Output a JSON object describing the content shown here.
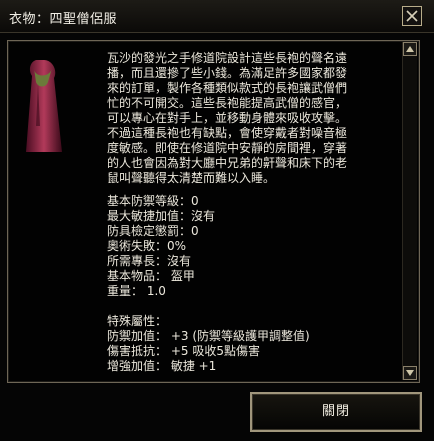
{
  "window": {
    "title": "衣物：四聖僧侶服"
  },
  "item": {
    "icon": "robe-icon",
    "description": "瓦沙的發光之手修道院設計這些長袍的聲名遠\n播，而且還摻了些小錢。為滿足許多國家都發\n來的訂單，製作各種類似款式的長袍讓武僧們\n忙的不可開交。這些長袍能提高武僧的感官，\n可以專心在對手上，並移動身體來吸收攻擊。\n不過這種長袍也有缺點，會使穿戴者對噪音極\n度敏感。即使在修道院中安靜的房間裡，穿著\n的人也會因為對大廳中兄弟的鼾聲和床下的老\n鼠叫聲聽得太清楚而難以入睡。",
    "stats": [
      "基本防禦等級：0",
      "最大敏捷加值：沒有",
      "防具檢定懲罰：0",
      "奧術失敗：0%",
      "所需專長：沒有",
      "基本物品： 盔甲",
      "重量： 1.0",
      "",
      "特殊屬性：",
      "防禦加值： +3 (防禦等級護甲調整值)",
      "傷害抵抗： +5 吸收5點傷害",
      "增強加值： 敏捷 +1"
    ]
  },
  "buttons": {
    "ok_label": "關閉"
  },
  "colors": {
    "background": "#050505",
    "text": "#ece8dc",
    "border": "#a0967c",
    "robe": "#9c2a4a"
  }
}
